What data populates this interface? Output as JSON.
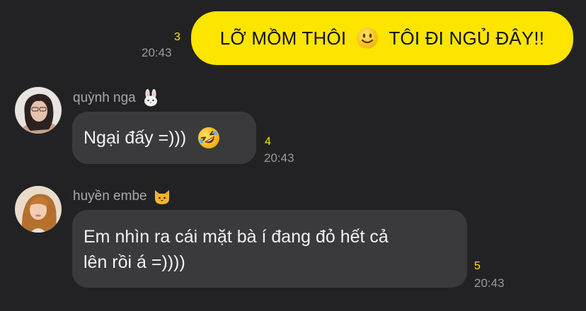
{
  "messages": {
    "outgoing": {
      "text_before": "LỠ MỒM THÔI",
      "emoji": "slightly-smiling-face-icon",
      "text_after": "TÔI ĐI NGỦ ĐÂY!!",
      "unread_count": "3",
      "time": "20:43",
      "bubble_color": "#FDE500"
    },
    "incoming": [
      {
        "sender": "quỳnh nga",
        "sender_emoji": "rabbit-face-icon",
        "text": "Ngại đấy =)))",
        "emoji": "rolling-on-floor-laughing-icon",
        "unread_count": "4",
        "time": "20:43"
      },
      {
        "sender": "huyền embe",
        "sender_emoji": "cat-face-icon",
        "line1": "Em nhìn ra cái mặt bà í đang đỏ hết cả",
        "line2": "lên rồi á =))))",
        "unread_count": "5",
        "time": "20:43"
      }
    ]
  },
  "colors": {
    "background": "#222224",
    "incoming_bubble": "#3A3A3D",
    "accent": "#FDE500"
  }
}
